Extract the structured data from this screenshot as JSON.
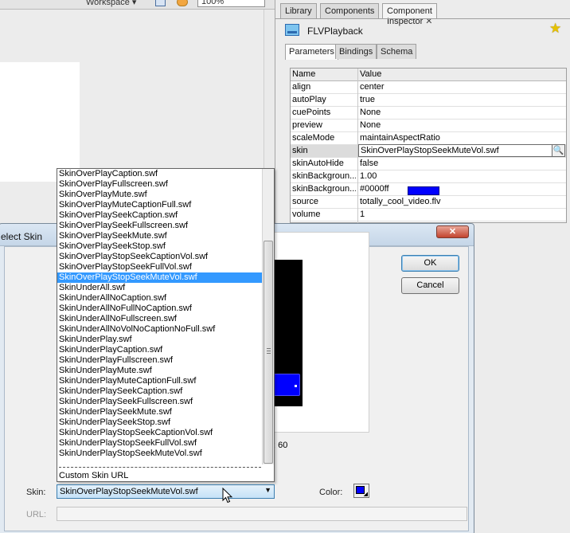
{
  "toolbar": {
    "workspace_label": "Workspace ▾",
    "zoom": "100%"
  },
  "panel": {
    "tabs": [
      {
        "label": "Library"
      },
      {
        "label": "Components"
      },
      {
        "label": "Component Inspector"
      }
    ],
    "close_glyph": "✕",
    "component_name": "FLVPlayback",
    "inner_tabs": [
      {
        "label": "Parameters"
      },
      {
        "label": "Bindings"
      },
      {
        "label": "Schema"
      }
    ],
    "table": {
      "headers": {
        "name": "Name",
        "value": "Value"
      },
      "rows": [
        {
          "name": "align",
          "value": "center"
        },
        {
          "name": "autoPlay",
          "value": "true"
        },
        {
          "name": "cuePoints",
          "value": "None"
        },
        {
          "name": "preview",
          "value": "None"
        },
        {
          "name": "scaleMode",
          "value": "maintainAspectRatio"
        },
        {
          "name": "skin",
          "value": "SkinOverPlayStopSeekMuteVol.swf"
        },
        {
          "name": "skinAutoHide",
          "value": "false"
        },
        {
          "name": "skinBackgroun...",
          "value": "1.00"
        },
        {
          "name": "skinBackgroun...",
          "value": "#0000ff"
        },
        {
          "name": "source",
          "value": "totally_cool_video.flv"
        },
        {
          "name": "volume",
          "value": "1"
        }
      ]
    }
  },
  "dialog": {
    "title": "elect Skin",
    "close_glyph": "✕",
    "ok_label": "OK",
    "cancel_label": "Cancel",
    "frame_text": "t: 60",
    "skin_label": "Skin:",
    "skin_value": "SkinOverPlayStopSeekMuteVol.swf",
    "url_label": "URL:",
    "color_label": "Color:"
  },
  "dropdown": {
    "items": [
      "SkinOverPlayCaption.swf",
      "SkinOverPlayFullscreen.swf",
      "SkinOverPlayMute.swf",
      "SkinOverPlayMuteCaptionFull.swf",
      "SkinOverPlaySeekCaption.swf",
      "SkinOverPlaySeekFullscreen.swf",
      "SkinOverPlaySeekMute.swf",
      "SkinOverPlaySeekStop.swf",
      "SkinOverPlayStopSeekCaptionVol.swf",
      "SkinOverPlayStopSeekFullVol.swf",
      "SkinOverPlayStopSeekMuteVol.swf",
      "SkinUnderAll.swf",
      "SkinUnderAllNoCaption.swf",
      "SkinUnderAllNoFullNoCaption.swf",
      "SkinUnderAllNoFullscreen.swf",
      "SkinUnderAllNoVolNoCaptionNoFull.swf",
      "SkinUnderPlay.swf",
      "SkinUnderPlayCaption.swf",
      "SkinUnderPlayFullscreen.swf",
      "SkinUnderPlayMute.swf",
      "SkinUnderPlayMuteCaptionFull.swf",
      "SkinUnderPlaySeekCaption.swf",
      "SkinUnderPlaySeekFullscreen.swf",
      "SkinUnderPlaySeekMute.swf",
      "SkinUnderPlaySeekStop.swf",
      "SkinUnderPlayStopSeekCaptionVol.swf",
      "SkinUnderPlayStopSeekFullVol.swf",
      "SkinUnderPlayStopSeekMuteVol.swf"
    ],
    "selected_index": 10,
    "custom_label": "Custom Skin URL"
  },
  "icons": {
    "component": "flvplayback-component-icon",
    "pin": "star-pin-icon",
    "search": "magnifier-icon",
    "cursor": "mouse-pointer-icon"
  },
  "colors": {
    "skin_color": "#0000ff",
    "selection": "#3399ff"
  }
}
